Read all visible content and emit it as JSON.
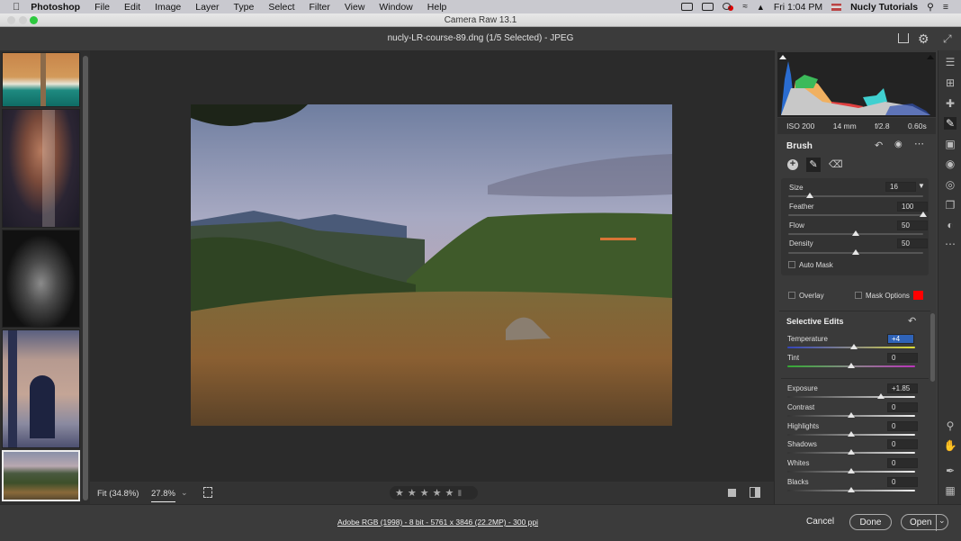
{
  "menubar": {
    "app_name": "Photoshop",
    "items": [
      "File",
      "Edit",
      "Image",
      "Layer",
      "Type",
      "Select",
      "Filter",
      "View",
      "Window",
      "Help"
    ],
    "clock": "Fri 1:04 PM",
    "user": "Nucly Tutorials"
  },
  "window": {
    "title": "Camera Raw 13.1",
    "document_title": "nucly-LR-course-89.dng (1/5 Selected)  -  JPEG"
  },
  "filmstrip": {
    "thumbnails": [
      {
        "name": "aerial-beach",
        "selected": false
      },
      {
        "name": "portrait-veil",
        "selected": false
      },
      {
        "name": "portrait-bw",
        "selected": false
      },
      {
        "name": "building-facade",
        "selected": false
      },
      {
        "name": "mountain-landscape",
        "selected": true
      }
    ]
  },
  "histogram": {
    "exif": {
      "iso": "ISO 200",
      "focal_length": "14 mm",
      "aperture": "f/2.8",
      "shutter": "0.60s"
    }
  },
  "brush_panel": {
    "title": "Brush",
    "size": {
      "label": "Size",
      "value": "16",
      "fraction": 0.16
    },
    "feather": {
      "label": "Feather",
      "value": "100",
      "fraction": 1.0
    },
    "flow": {
      "label": "Flow",
      "value": "50",
      "fraction": 0.5
    },
    "density": {
      "label": "Density",
      "value": "50",
      "fraction": 0.5
    },
    "auto_mask": {
      "label": "Auto Mask",
      "checked": false
    },
    "overlay": {
      "label": "Overlay",
      "checked": false
    },
    "mask_options": {
      "label": "Mask Options",
      "checked": false,
      "color": "#ff0000"
    }
  },
  "selective_edits": {
    "title": "Selective Edits",
    "sliders": [
      {
        "label": "Temperature",
        "value": "+4",
        "fraction": 0.52,
        "kind": "temp"
      },
      {
        "label": "Tint",
        "value": "0",
        "fraction": 0.5,
        "kind": "tint"
      },
      {
        "label": "Exposure",
        "value": "+1.85",
        "fraction": 0.73,
        "kind": "tone"
      },
      {
        "label": "Contrast",
        "value": "0",
        "fraction": 0.5,
        "kind": "tone"
      },
      {
        "label": "Highlights",
        "value": "0",
        "fraction": 0.5,
        "kind": "tone"
      },
      {
        "label": "Shadows",
        "value": "0",
        "fraction": 0.5,
        "kind": "tone"
      },
      {
        "label": "Whites",
        "value": "0",
        "fraction": 0.5,
        "kind": "tone"
      },
      {
        "label": "Blacks",
        "value": "0",
        "fraction": 0.5,
        "kind": "tone"
      }
    ]
  },
  "viewbar": {
    "fit_label": "Fit (34.8%)",
    "zoom_value": "27.8%",
    "rating_stars": 5
  },
  "footer": {
    "workflow_info": "Adobe RGB (1998) - 8 bit - 5761 x 3846 (22.2MP) - 300 ppi",
    "cancel_label": "Cancel",
    "done_label": "Done",
    "open_label": "Open"
  }
}
